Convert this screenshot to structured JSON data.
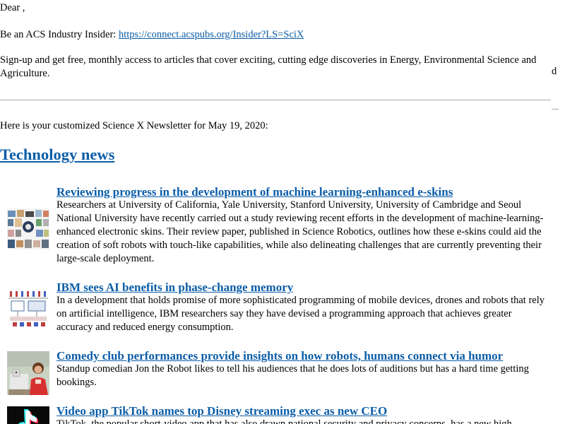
{
  "greeting": "Dear ,",
  "insider": {
    "text": "Be an ACS Industry Insider: ",
    "link": "https://connect.acspubs.org/Insider?LS=SciX"
  },
  "signup_text": "Sign-up and get free, monthly access to articles that cover exciting, cutting edge discoveries in Energy, Environmental Science and Agriculture.",
  "stray_char": "d",
  "intro": "Here is your customized Science X Newsletter for May 19, 2020:",
  "section_title": "Technology news",
  "articles": [
    {
      "title": "Reviewing progress in the development of machine learning-enhanced e-skins",
      "summary": "Researchers at University of California, Yale University, Stanford University, University of Cambridge and Seoul National University have recently carried out a study reviewing recent efforts in the development of machine-learning-enhanced electronic skins. Their review paper, published in Science Robotics, outlines how these e-skins could aid the creation of soft robots with touch-like capabilities, while also delineating challenges that are currently preventing their large-scale deployment.",
      "thumb_icon": "e-skin-figure-thumbnail"
    },
    {
      "title": "IBM sees AI benefits in phase-change memory",
      "summary": "In a development that holds promise of more sophisticated programming of mobile devices, drones and robots that rely on artificial intelligence, IBM researchers say they have devised a programming approach that achieves greater accuracy and reduced energy consumption.",
      "thumb_icon": "phase-change-memory-diagram-thumbnail"
    },
    {
      "title": "Comedy club performances provide insights on how robots, humans connect via humor",
      "summary": "Standup comedian Jon the Robot likes to tell his audiences that he does lots of auditions but has a hard time getting bookings.",
      "thumb_icon": "robot-comedian-photo-thumbnail"
    },
    {
      "title": "Video app TikTok names top Disney streaming exec as new CEO",
      "summary": "TikTok, the popular short-video app that has also drawn national security and privacy concerns, has a new high",
      "thumb_icon": "tiktok-logo-thumbnail"
    }
  ],
  "colors": {
    "link": "#0b5da8",
    "rule": "#a8a8a8",
    "text": "#000000"
  }
}
